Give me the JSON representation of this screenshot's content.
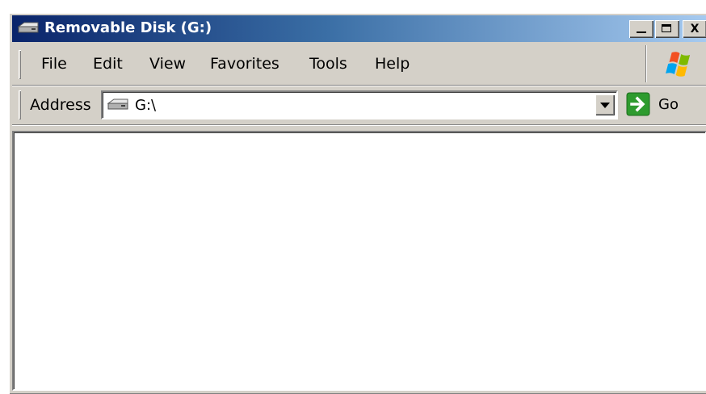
{
  "window": {
    "title": "Removable Disk (G:)",
    "title_icon": "removable-drive-icon",
    "controls": {
      "minimize_icon": "minimize-icon",
      "maximize_icon": "maximize-icon",
      "close_label": "X"
    }
  },
  "menubar": {
    "items": [
      {
        "label": "File"
      },
      {
        "label": "Edit"
      },
      {
        "label": "View"
      },
      {
        "label": "Favorites"
      },
      {
        "label": "Tools"
      },
      {
        "label": "Help"
      }
    ],
    "logo_icon": "windows-logo-icon"
  },
  "addressbar": {
    "label": "Address",
    "value": "G:\\",
    "drive_icon": "removable-drive-icon",
    "dropdown_icon": "chevron-down-icon",
    "go_label": "Go",
    "go_icon": "go-arrow-icon"
  },
  "colors": {
    "titlebar_start": "#0a246a",
    "titlebar_end": "#a6caf0",
    "chrome": "#d4d0c8",
    "go_green": "#2e9b2e"
  }
}
